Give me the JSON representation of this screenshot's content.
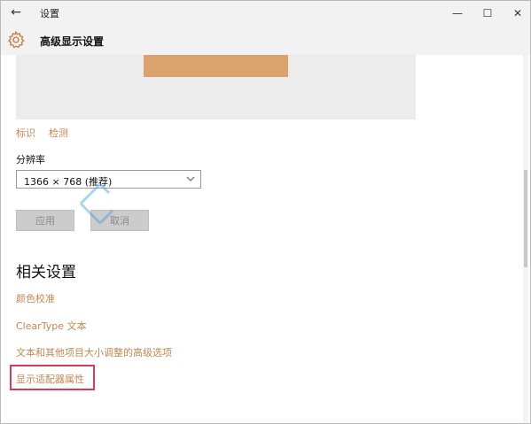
{
  "window": {
    "title": "设置",
    "minimize_glyph": "—",
    "maximize_glyph": "☐",
    "close_glyph": "✕",
    "back_glyph": "←"
  },
  "header": {
    "title": "高级显示设置",
    "icon": "gear-icon"
  },
  "display": {
    "identify_label": "标识",
    "detect_label": "检测"
  },
  "resolution": {
    "label": "分辨率",
    "value": "1366 × 768 (推荐)"
  },
  "actions": {
    "apply_label": "应用",
    "cancel_label": "取消"
  },
  "related": {
    "title": "相关设置",
    "links": [
      "颜色校准",
      "ClearType 文本",
      "文本和其他项目大小调整的高级选项",
      "显示适配器属性"
    ]
  },
  "colors": {
    "accent": "#c2874f",
    "monitor": "#d9a26e",
    "highlight": "#d93a57",
    "watermark": "#3a9ad9"
  }
}
